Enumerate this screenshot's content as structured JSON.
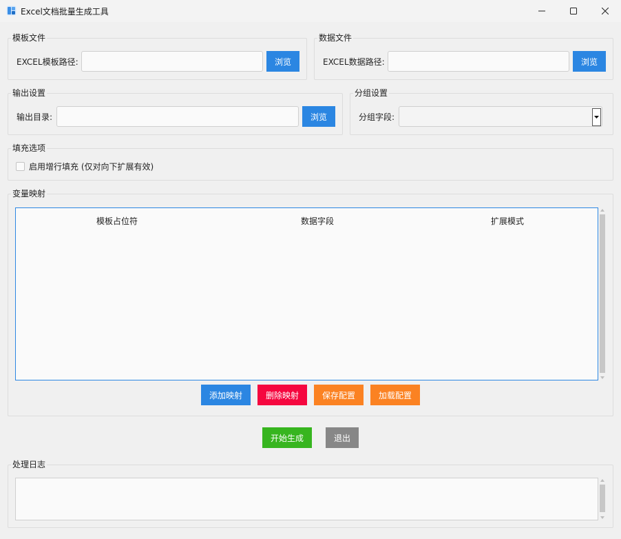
{
  "window": {
    "title": "Excel文档批量生成工具"
  },
  "template_group": {
    "title": "模板文件",
    "label": "EXCEL模板路径:",
    "value": "",
    "browse_label": "浏览"
  },
  "data_group": {
    "title": "数据文件",
    "label": "EXCEL数据路径:",
    "value": "",
    "browse_label": "浏览"
  },
  "output_group": {
    "title": "输出设置",
    "label": "输出目录:",
    "value": "",
    "browse_label": "浏览"
  },
  "grouping_group": {
    "title": "分组设置",
    "label": "分组字段:",
    "selected": ""
  },
  "fill_group": {
    "title": "填充选项",
    "checkbox_label": "启用增行填充 (仅对向下扩展有效)",
    "checked": false
  },
  "mapping_group": {
    "title": "变量映射",
    "columns": [
      "模板占位符",
      "数据字段",
      "扩展模式"
    ],
    "rows": [],
    "buttons": {
      "add": "添加映射",
      "delete": "删除映射",
      "save": "保存配置",
      "load": "加载配置"
    }
  },
  "actions": {
    "start": "开始生成",
    "exit": "退出"
  },
  "log_group": {
    "title": "处理日志",
    "text": ""
  },
  "colors": {
    "primary_blue": "#2b86e2",
    "danger_red": "#f5073f",
    "warning_orange": "#fb8222",
    "success_green": "#37b51f",
    "neutral_grey": "#878787"
  }
}
